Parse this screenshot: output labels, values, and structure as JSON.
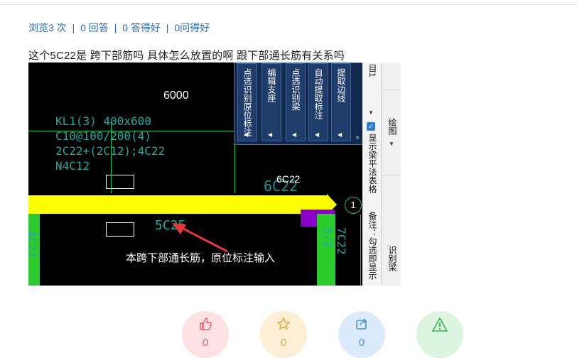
{
  "stats": {
    "views": "浏览3 次",
    "answers": "0 回答",
    "good_answers": "0 答得好",
    "helpful": "0问得好",
    "separator": "|"
  },
  "question_text": "这个5C22是  跨下部筋吗  具体怎么放置的啊  跟下部通长筋有关系吗",
  "screenshot": {
    "span_length": "6000",
    "beam_label": [
      "KL1(3) 400x600",
      "C10@100/200(4)",
      "2C22+(2C12);4C22",
      "N4C12"
    ],
    "top_rebar_white": "6C22",
    "top_rebar_teal": "6C22",
    "bottom_rebar": "5C25",
    "left_column_rebar": "4C22",
    "right_column_rebar": "7C22 5/2",
    "axis_number": "1",
    "annotation": "本跨下部通长筋，原位标注输入",
    "panel_buttons": [
      "点选识别原位标注",
      "编辑支座",
      "点选识别梁",
      "自动提取标注",
      "提取边线"
    ],
    "panel_close": "×",
    "side_top_tab": "目1",
    "side_draw": "绘图",
    "side_checkbox_label": "显示梁平法表格",
    "side_note": "备注：勾选即显示",
    "side_identify": "识别梁"
  },
  "actions": [
    {
      "name": "like",
      "count": "0",
      "color": "#fde1e3",
      "icon_color": "#e0606e"
    },
    {
      "name": "favorite",
      "count": "0",
      "color": "#fdeed5",
      "icon_color": "#e8a838"
    },
    {
      "name": "share",
      "count": "0",
      "color": "#dcebfb",
      "icon_color": "#4a90d9"
    },
    {
      "name": "report",
      "count": "",
      "color": "#dcf5e0",
      "icon_color": "#3fae55"
    }
  ]
}
